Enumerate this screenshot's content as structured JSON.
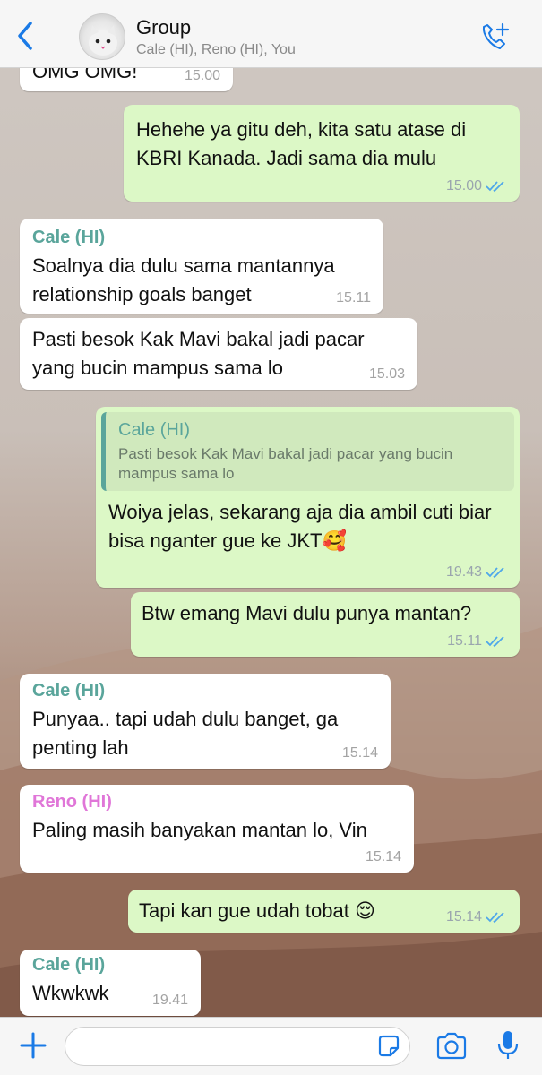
{
  "header": {
    "title": "Group",
    "subtitle": "Cale (HI), Reno (HI), You"
  },
  "messages": [
    {
      "direction": "in",
      "text": "OMG OMG!",
      "time": "15.00"
    },
    {
      "direction": "out",
      "text": "Hehehe ya gitu deh, kita satu atase di KBRI Kanada. Jadi sama dia mulu",
      "time": "15.00",
      "status": "read"
    },
    {
      "direction": "in",
      "sender": "Cale (HI)",
      "text": "Soalnya dia dulu sama mantannya relationship goals banget",
      "time": "15.11"
    },
    {
      "direction": "in",
      "text": "Pasti besok Kak Mavi bakal jadi pacar yang bucin mampus sama lo",
      "time": "15.03"
    },
    {
      "direction": "out",
      "quote": {
        "sender": "Cale (HI)",
        "text": "Pasti besok Kak Mavi bakal jadi pacar yang bucin mampus sama lo"
      },
      "text": "Woiya jelas, sekarang aja dia ambil cuti biar bisa nganter gue ke JKT",
      "emoji": "🥰",
      "time": "19.43",
      "status": "read"
    },
    {
      "direction": "out",
      "text": "Btw emang Mavi dulu punya mantan?",
      "time": "15.11",
      "status": "read"
    },
    {
      "direction": "in",
      "sender": "Cale (HI)",
      "text": "Punyaa.. tapi udah dulu banget, ga penting lah",
      "time": "15.14"
    },
    {
      "direction": "in",
      "sender": "Reno (HI)",
      "text": "Paling masih banyakan mantan lo, Vin",
      "time": "15.14"
    },
    {
      "direction": "out",
      "text": "Tapi kan gue udah tobat",
      "emoji": "😌",
      "time": "15.14",
      "status": "read"
    },
    {
      "direction": "in",
      "sender": "Cale (HI)",
      "text": "Wkwkwk",
      "time": "19.41"
    }
  ],
  "composer": {
    "placeholder": ""
  },
  "colors": {
    "accent": "#1a7ae6",
    "outgoing_bubble": "#dcf8c6",
    "incoming_bubble": "#ffffff",
    "sender_cale": "#5aa59b",
    "sender_reno": "#e076d8"
  },
  "icons": [
    "back-chevron-icon",
    "group-avatar",
    "add-call-icon",
    "double-check-icon",
    "plus-icon",
    "sticker-icon",
    "camera-icon",
    "microphone-icon"
  ]
}
